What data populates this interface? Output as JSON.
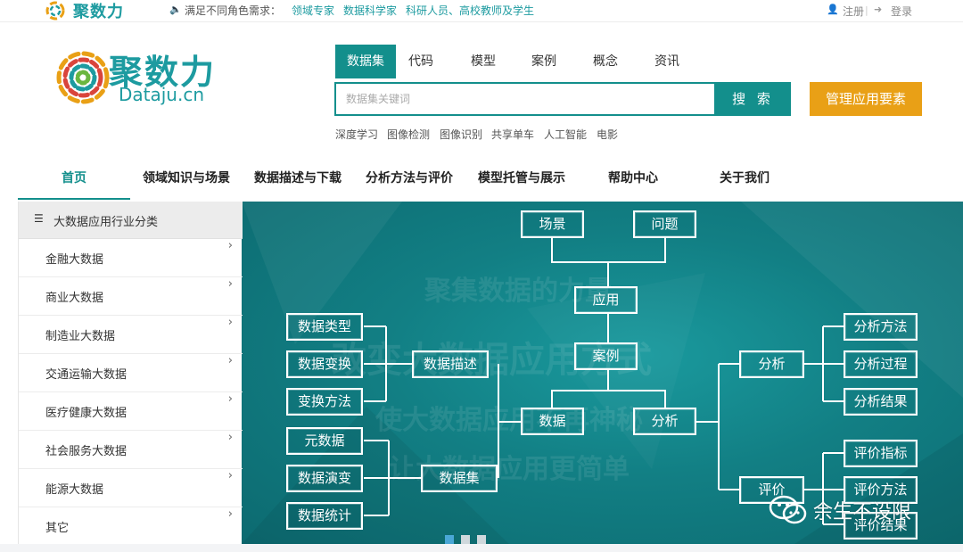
{
  "topbar": {
    "mini_brand": "聚数力",
    "need_label": "满足不同角色需求：",
    "roles": [
      "领域专家",
      "数据科学家",
      "科研人员、高校教师及学生"
    ],
    "register": "注册",
    "login": "登录"
  },
  "header": {
    "brand": "聚数力",
    "brand_sub": "Dataju.cn",
    "search_tabs": [
      "数据集",
      "代码",
      "模型",
      "案例",
      "概念",
      "资讯"
    ],
    "search_placeholder": "数据集关键词",
    "search_button": "搜 索",
    "manage_button": "管理应用要素",
    "hot_keywords": [
      "深度学习",
      "图像检测",
      "图像识别",
      "共享单车",
      "人工智能",
      "电影"
    ]
  },
  "nav": {
    "items": [
      "首页",
      "领域知识与场景",
      "数据描述与下载",
      "分析方法与评价",
      "模型托管与展示",
      "帮助中心",
      "关于我们"
    ],
    "active": "首页"
  },
  "sidebar": {
    "title": "大数据应用行业分类",
    "items": [
      "金融大数据",
      "商业大数据",
      "制造业大数据",
      "交通运输大数据",
      "医疗健康大数据",
      "社会服务大数据",
      "能源大数据",
      "其它"
    ]
  },
  "banner": {
    "watermarks": [
      "聚集数据的力量",
      "改变大数据应用方式",
      "使大数据应用不再神秘",
      "让大数据应用更简单"
    ],
    "nodes": {
      "scene": "场景",
      "problem": "问题",
      "application": "应用",
      "case": "案例",
      "data": "数据",
      "analysis": "分析",
      "data_desc": "数据描述",
      "data_type": "数据类型",
      "data_transform": "数据变换",
      "transform_method": "变换方法",
      "dataset": "数据集",
      "metadata": "元数据",
      "data_evolution": "数据演变",
      "data_stats": "数据统计",
      "analysis_right": "分析",
      "analysis_method": "分析方法",
      "analysis_process": "分析过程",
      "analysis_result": "分析结果",
      "evaluation": "评价",
      "eval_index": "评价指标",
      "eval_method": "评价方法",
      "eval_result": "评价结果"
    },
    "slides": 3,
    "active_slide": 1
  },
  "watermark_badge": "余生不设限",
  "colors": {
    "primary": "#138f8c",
    "accent": "#e9a016",
    "banner": "#127f84"
  }
}
